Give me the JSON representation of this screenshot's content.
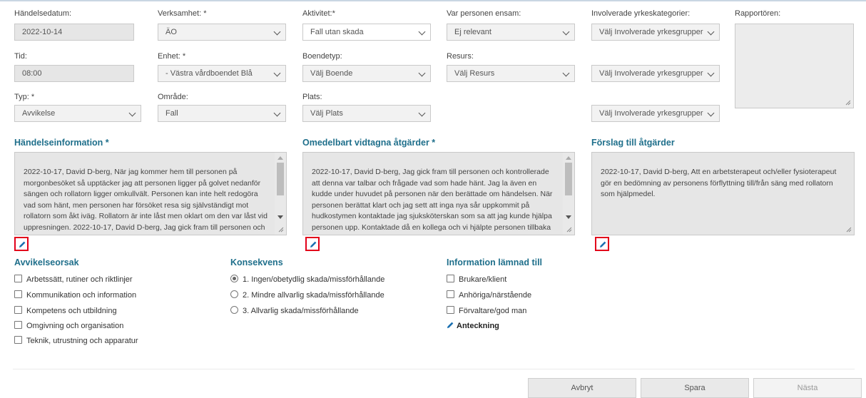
{
  "fields": {
    "handelsedatum": {
      "label": "Händelsedatum:",
      "value": "2022-10-14"
    },
    "verksamhet": {
      "label": "Verksamhet: *",
      "value": "ÄO"
    },
    "aktivitet": {
      "label": "Aktivitet:*",
      "value": "Fall utan skada"
    },
    "ensam": {
      "label": "Var personen ensam:",
      "value": "Ej relevant"
    },
    "yrkeskategorier": {
      "label": "Involverade yrkeskategorier:",
      "values": [
        "Välj Involverade yrkesgrupper",
        "Välj Involverade yrkesgrupper",
        "Välj Involverade yrkesgrupper"
      ]
    },
    "rapportoren": {
      "label": "Rapportören:",
      "value": ""
    },
    "tid": {
      "label": "Tid:",
      "value": "08:00"
    },
    "enhet": {
      "label": "Enhet: *",
      "value": "- Västra vårdboendet Blå"
    },
    "boendetyp": {
      "label": "Boendetyp:",
      "value": "Välj Boende"
    },
    "resurs": {
      "label": "Resurs:",
      "value": "Välj Resurs"
    },
    "typ": {
      "label": "Typ: *",
      "value": "Avvikelse"
    },
    "omrade": {
      "label": "Område:",
      "value": "Fall"
    },
    "plats": {
      "label": "Plats:",
      "value": "Välj Plats"
    }
  },
  "sections": {
    "handelseinformation": {
      "title": "Händelseinformation *",
      "text": "2022-10-17, David D-berg, När jag kommer hem till personen på morgonbesöket så upptäcker jag att personen ligger på golvet nedanför sängen och rollatorn ligger omkullvält. Personen kan inte helt redogöra vad som hänt, men personen har försöket resa sig självständigt mot rollatorn som åkt iväg. Rollatorn är inte låst men oklart om den var låst vid uppresningen. 2022-10-17, David D-berg, Jag gick fram till personen och kontrollerade läget."
    },
    "atgarder": {
      "title": "Omedelbart vidtagna åtgärder *",
      "text": "2022-10-17, David D-berg, Jag gick fram till personen och kontrollerade att denna var talbar och frågade vad som hade hänt. Jag la även en kudde under huvudet på personen när den berättade om händelsen. När personen berättat klart och jag sett att inga nya sår uppkommit på hudkostymen kontaktade jag sjuksköterskan som sa att jag kunde hjälpa personen upp. Kontaktade då en kollega och vi hjälpte personen tillbaka upp i sängen och kontrollerade att allt var i ordning."
    },
    "forslag": {
      "title": "Förslag till åtgärder",
      "text": "2022-10-17, David D-berg, Att en arbetsterapeut och/eller fysioterapeut gör en bedömning av personens förflyttning till/från säng med rollatorn som hjälpmedel."
    }
  },
  "avvikelseorsak": {
    "title": "Avvikelseorsak",
    "options": [
      "Arbetssätt, rutiner och riktlinjer",
      "Kommunikation och information",
      "Kompetens och utbildning",
      "Omgivning och organisation",
      "Teknik, utrustning och apparatur"
    ]
  },
  "konsekvens": {
    "title": "Konsekvens",
    "options": [
      "1. Ingen/obetydlig skada/missförhållande",
      "2. Mindre allvarlig skada/missförhållande",
      "3. Allvarlig skada/missförhållande"
    ],
    "selected_index": 0
  },
  "information": {
    "title": "Information lämnad till",
    "options": [
      "Brukare/klient",
      "Anhöriga/närstående",
      "Förvaltare/god man"
    ],
    "note_link": "Anteckning"
  },
  "buttons": {
    "cancel": "Avbryt",
    "save": "Spara",
    "next": "Nästa"
  },
  "icons": {
    "edit": "pencil-icon",
    "select": "chevron-down-icon",
    "checkbox": "checkbox-icon",
    "radio": "radio-icon"
  },
  "colors": {
    "accent": "#1f6f8b",
    "highlight": "#e2001a",
    "pencil": "#1a6fb0"
  }
}
